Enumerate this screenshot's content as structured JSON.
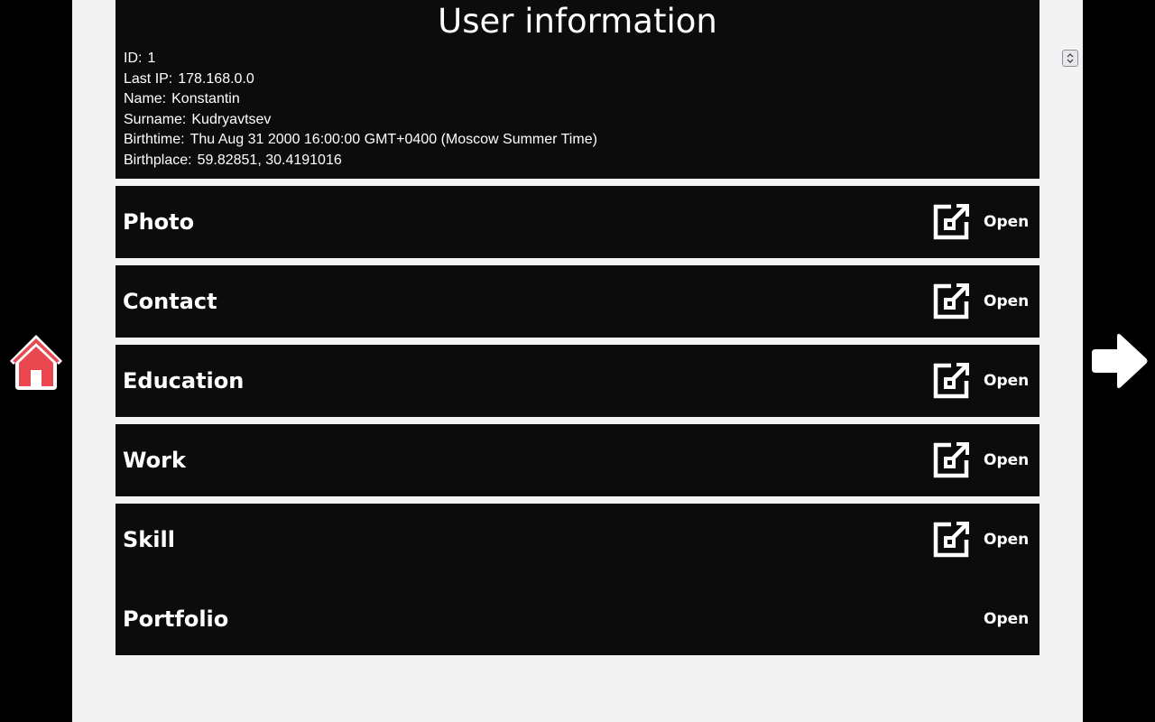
{
  "title": "User information",
  "user": {
    "fields": [
      {
        "label": "ID:",
        "value": "1"
      },
      {
        "label": "Last IP:",
        "value": "178.168.0.0"
      },
      {
        "label": "Name:",
        "value": "Konstantin"
      },
      {
        "label": "Surname:",
        "value": "Kudryavtsev"
      },
      {
        "label": "Birthtime:",
        "value": "Thu Aug 31 2000 16:00:00 GMT+0400 (Moscow Summer Time)"
      },
      {
        "label": "Birthplace:",
        "value": "59.82851, 30.4191016"
      }
    ]
  },
  "sections": [
    {
      "title": "Photo",
      "open_label": "Open",
      "icon": "external-link-icon"
    },
    {
      "title": "Contact",
      "open_label": "Open",
      "icon": "external-link-icon"
    },
    {
      "title": "Education",
      "open_label": "Open",
      "icon": "external-link-icon"
    },
    {
      "title": "Work",
      "open_label": "Open",
      "icon": "external-link-icon"
    },
    {
      "title": "Skill",
      "open_label": "Open",
      "icon": "external-link-icon"
    },
    {
      "title": "Portfolio",
      "open_label": "Open"
    }
  ],
  "nav": {
    "home_icon": "home-icon",
    "next_icon": "arrow-right-icon"
  },
  "colors": {
    "page_background": "#000000",
    "content_background": "#f3f3f3",
    "panel_background": "#0c0c0d",
    "text": "#ffffff",
    "home_roof": "#e8474f",
    "home_body": "#ffffff"
  }
}
